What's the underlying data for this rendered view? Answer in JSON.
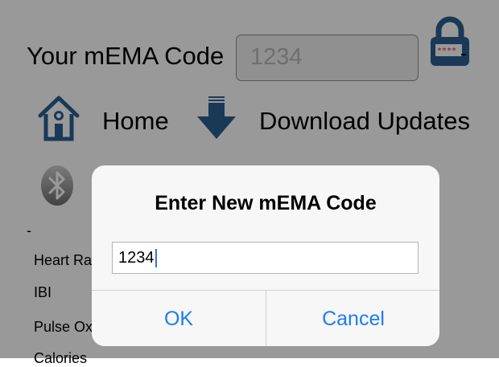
{
  "header": {
    "code_label": "Your mEMA Code",
    "code_value": "1234",
    "lock_icon": "padlock-icon"
  },
  "nav": {
    "home_label": "Home",
    "home_icon": "home-icon",
    "download_label": "Download Updates",
    "download_icon": "download-arrow-icon",
    "bluetooth_icon": "bluetooth-icon"
  },
  "sensors": {
    "dash": "-",
    "items": [
      "Heart Ra",
      "IBI",
      "Pulse Ox",
      "Calories"
    ]
  },
  "dialog": {
    "title": "Enter New mEMA Code",
    "input_value": "1234",
    "ok_label": "OK",
    "cancel_label": "Cancel"
  },
  "colors": {
    "accent": "#1a7cf5",
    "icon_blue": "#2a5f8f",
    "overlay": "rgba(0,0,0,0.40)"
  }
}
